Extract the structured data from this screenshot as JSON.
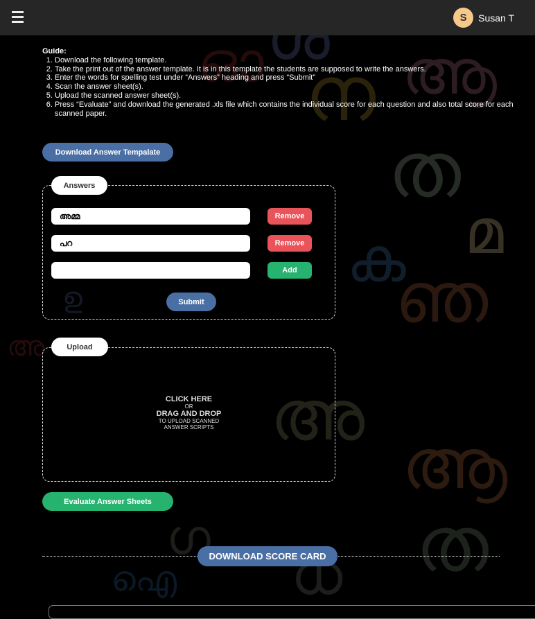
{
  "header": {
    "menu_icon": "hamburger-icon",
    "user_initial": "S",
    "user_name": "Susan T"
  },
  "guide": {
    "title": "Guide:",
    "steps": [
      "Download the following template.",
      "Take the print out of the answer template. It is in this template the students are supposed to write the answers.",
      "Enter the words for spelling test under “Answers” heading and press “Submit”",
      "Scan the answer sheet(s).",
      "Upload the scanned answer sheet(s).",
      "Press “Evaluate” and download the generated .xls file which contains the individual score for each question and also total score for each scanned paper."
    ]
  },
  "download_template_label": "Download Answer Tempalate",
  "answers": {
    "legend": "Answers",
    "rows": [
      {
        "value": "അമ്മ",
        "button": "Remove"
      },
      {
        "value": "പറ",
        "button": "Remove"
      },
      {
        "value": "",
        "button": "Add"
      }
    ],
    "submit_label": "Submit"
  },
  "upload": {
    "legend": "Upload",
    "line1": "CLICK HERE",
    "line2": "OR",
    "line3": "DRAG AND DROP",
    "line4": "TO UPLOAD SCANNED",
    "line5": "ANSWER SCRIPTS"
  },
  "evaluate_label": "Evaluate Answer Sheets",
  "download_score_label": "DOWNLOAD SCORE CARD",
  "colors": {
    "primary": "#4a6fa5",
    "success": "#26b36f",
    "danger": "#e9545a",
    "header": "#262626"
  },
  "background_glyphs": [
    "ശ",
    "ഓ",
    "ന",
    "ആ",
    "ത",
    "മ",
    "ഞ",
    "ഴ",
    "ക",
    "ഉ",
    "ര",
    "ഒ",
    "അ",
    "ബ",
    "ളു",
    "ഗ",
    "ധ",
    "ഐ"
  ]
}
